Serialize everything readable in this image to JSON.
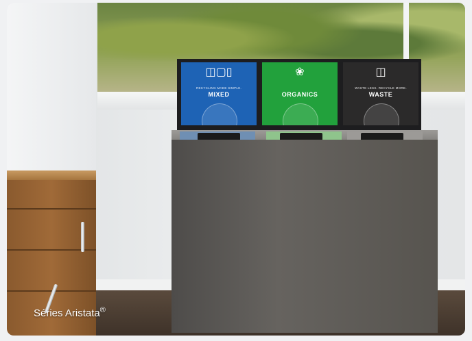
{
  "caption": {
    "text": "Séries Aristata",
    "mark": "®"
  },
  "signs": [
    {
      "tagline": "RECYCLING MADE SIMPLE.",
      "name": "MIXED",
      "icon": "bottle-paper-can-icon",
      "color": "#1e63b5"
    },
    {
      "tagline": "",
      "name": "ORGANICS",
      "icon": "apple-core-icon",
      "color": "#22a13c"
    },
    {
      "tagline": "WASTE LESS. RECYCLE MORE.",
      "name": "WASTE",
      "icon": "trash-can-icon",
      "color": "#2b2a2a"
    }
  ],
  "colors": {
    "bin_body": "#5a5753",
    "frame": "#f0f1f3"
  }
}
